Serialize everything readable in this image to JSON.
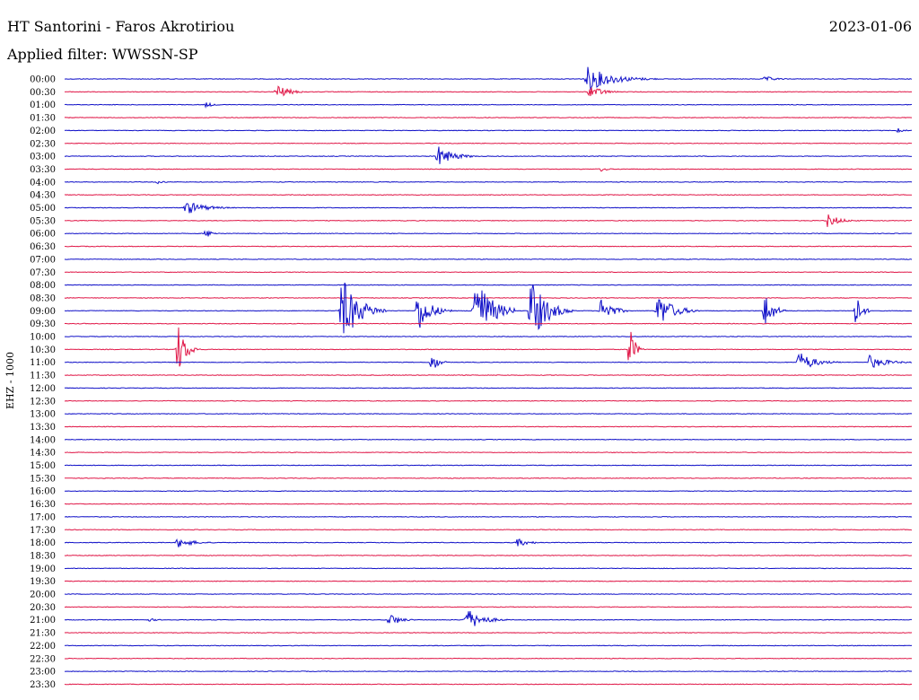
{
  "header": {
    "station": "HT Santorini - Faros Akrotiriou",
    "date": "2023-01-06",
    "filter_label": "Applied filter: WWSSN-SP"
  },
  "chart_data": {
    "type": "line",
    "title": "HT Santorini - Faros Akrotiriou",
    "ylabel": "EHZ - 1000",
    "row_labels": [
      "00:00",
      "00:30",
      "01:00",
      "01:30",
      "02:00",
      "02:30",
      "03:00",
      "03:30",
      "04:00",
      "04:30",
      "05:00",
      "05:30",
      "06:00",
      "06:30",
      "07:00",
      "07:30",
      "08:00",
      "08:30",
      "09:00",
      "09:30",
      "10:00",
      "10:30",
      "11:00",
      "11:30",
      "12:00",
      "12:30",
      "13:00",
      "13:30",
      "14:00",
      "14:30",
      "15:00",
      "15:30",
      "16:00",
      "16:30",
      "17:00",
      "17:30",
      "18:00",
      "18:30",
      "19:00",
      "19:30",
      "20:00",
      "20:30",
      "21:00",
      "21:30",
      "22:00",
      "22:30",
      "23:00",
      "23:30"
    ],
    "colors": {
      "even_rows": "#1010c8",
      "odd_rows": "#e01848"
    },
    "time_per_row_minutes": 30,
    "events": [
      {
        "row": "00:00",
        "minute": 18.5,
        "amplitude": 14,
        "duration_min": 2.5
      },
      {
        "row": "00:00",
        "minute": 24.8,
        "amplitude": 3,
        "duration_min": 1.2
      },
      {
        "row": "00:30",
        "minute": 7.5,
        "amplitude": 9,
        "duration_min": 1.2
      },
      {
        "row": "00:30",
        "minute": 18.6,
        "amplitude": 8,
        "duration_min": 1.2
      },
      {
        "row": "01:00",
        "minute": 5.0,
        "amplitude": 3,
        "duration_min": 0.8
      },
      {
        "row": "02:00",
        "minute": 29.5,
        "amplitude": 3,
        "duration_min": 0.6
      },
      {
        "row": "03:00",
        "minute": 13.2,
        "amplitude": 12,
        "duration_min": 1.5
      },
      {
        "row": "03:30",
        "minute": 19.0,
        "amplitude": 3,
        "duration_min": 0.6
      },
      {
        "row": "04:00",
        "minute": 3.3,
        "amplitude": 2,
        "duration_min": 0.8
      },
      {
        "row": "05:00",
        "minute": 4.3,
        "amplitude": 8,
        "duration_min": 1.8
      },
      {
        "row": "05:30",
        "minute": 27.0,
        "amplitude": 8,
        "duration_min": 1.2
      },
      {
        "row": "06:00",
        "minute": 5.0,
        "amplitude": 5,
        "duration_min": 0.7
      },
      {
        "row": "09:00",
        "minute": 9.8,
        "amplitude": 40,
        "duration_min": 1.6
      },
      {
        "row": "09:00",
        "minute": 12.5,
        "amplitude": 25,
        "duration_min": 1.2
      },
      {
        "row": "09:00",
        "minute": 14.5,
        "amplitude": 45,
        "duration_min": 1.5
      },
      {
        "row": "09:00",
        "minute": 16.5,
        "amplitude": 38,
        "duration_min": 1.5
      },
      {
        "row": "09:00",
        "minute": 19.0,
        "amplitude": 18,
        "duration_min": 1.0
      },
      {
        "row": "09:00",
        "minute": 21.0,
        "amplitude": 20,
        "duration_min": 1.5
      },
      {
        "row": "09:00",
        "minute": 24.8,
        "amplitude": 22,
        "duration_min": 0.8
      },
      {
        "row": "09:00",
        "minute": 28.0,
        "amplitude": 20,
        "duration_min": 0.6
      },
      {
        "row": "10:30",
        "minute": 4.0,
        "amplitude": 30,
        "duration_min": 0.8
      },
      {
        "row": "10:30",
        "minute": 20.0,
        "amplitude": 28,
        "duration_min": 0.5
      },
      {
        "row": "11:00",
        "minute": 13.0,
        "amplitude": 12,
        "duration_min": 0.6
      },
      {
        "row": "11:00",
        "minute": 28.5,
        "amplitude": 8,
        "duration_min": 1.6
      },
      {
        "row": "11:00",
        "minute": 26.0,
        "amplitude": 12,
        "duration_min": 1.5
      },
      {
        "row": "18:00",
        "minute": 4.0,
        "amplitude": 6,
        "duration_min": 1.5
      },
      {
        "row": "18:00",
        "minute": 16.0,
        "amplitude": 5,
        "duration_min": 1.2
      },
      {
        "row": "21:00",
        "minute": 11.5,
        "amplitude": 8,
        "duration_min": 1.0
      },
      {
        "row": "21:00",
        "minute": 14.2,
        "amplitude": 14,
        "duration_min": 1.5
      },
      {
        "row": "21:00",
        "minute": 3.0,
        "amplitude": 2,
        "duration_min": 0.8
      }
    ]
  }
}
